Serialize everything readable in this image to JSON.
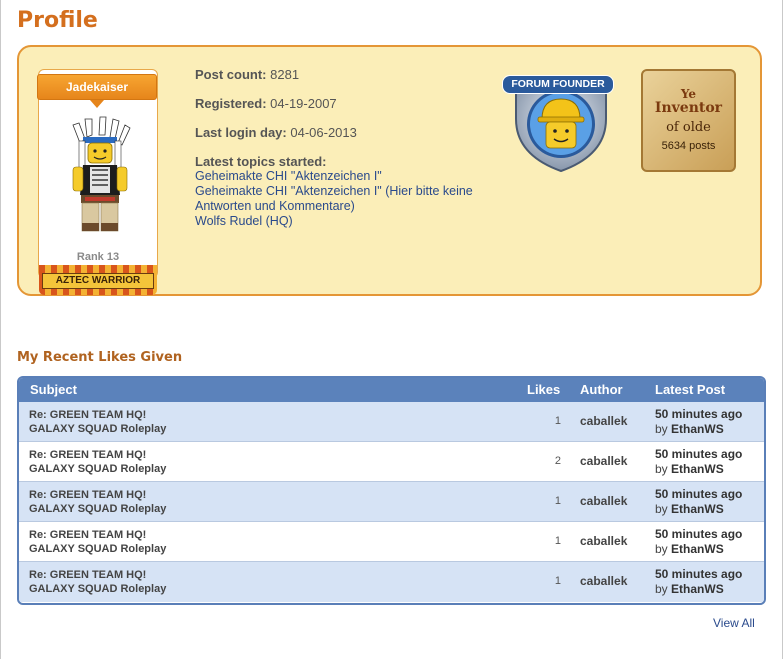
{
  "page": {
    "title": "Profile"
  },
  "card": {
    "name": "Jadekaiser",
    "rank": "Rank 13",
    "banner": "AZTEC WARRIOR"
  },
  "info": {
    "post_count_label": "Post count:",
    "post_count": "8281",
    "registered_label": "Registered:",
    "registered": "04-19-2007",
    "last_login_label": "Last login day:",
    "last_login": "04-06-2013",
    "topics_label": "Latest topics started:",
    "topics": [
      "Geheimakte CHI \"Aktenzeichen I\"",
      "Geheimakte CHI \"Aktenzeichen I\" (Hier bitte keine Antworten und Kommentare)",
      "Wolfs Rudel (HQ)"
    ]
  },
  "badges": {
    "founder": "FORUM FOUNDER",
    "inventor_line1": "Ye",
    "inventor_line2": "Inventor",
    "inventor_line3": "of olde",
    "inventor_posts": "5634 posts"
  },
  "likes": {
    "title": "My Recent Likes Given",
    "columns": {
      "subject": "Subject",
      "likes": "Likes",
      "author": "Author",
      "latest": "Latest Post"
    },
    "rows": [
      {
        "subject": "Re: GREEN TEAM HQ!",
        "forum": "GALAXY SQUAD Roleplay",
        "likes": "1",
        "author": "caballek",
        "time": "50 minutes ago",
        "by_prefix": "by",
        "by": "EthanWS"
      },
      {
        "subject": "Re: GREEN TEAM HQ!",
        "forum": "GALAXY SQUAD Roleplay",
        "likes": "2",
        "author": "caballek",
        "time": "50 minutes ago",
        "by_prefix": "by",
        "by": "EthanWS"
      },
      {
        "subject": "Re: GREEN TEAM HQ!",
        "forum": "GALAXY SQUAD Roleplay",
        "likes": "1",
        "author": "caballek",
        "time": "50 minutes ago",
        "by_prefix": "by",
        "by": "EthanWS"
      },
      {
        "subject": "Re: GREEN TEAM HQ!",
        "forum": "GALAXY SQUAD Roleplay",
        "likes": "1",
        "author": "caballek",
        "time": "50 minutes ago",
        "by_prefix": "by",
        "by": "EthanWS"
      },
      {
        "subject": "Re: GREEN TEAM HQ!",
        "forum": "GALAXY SQUAD Roleplay",
        "likes": "1",
        "author": "caballek",
        "time": "50 minutes ago",
        "by_prefix": "by",
        "by": "EthanWS"
      }
    ],
    "view_all": "View All"
  },
  "colors": {
    "accent": "#d46f1e",
    "panel": "#fbeeb8",
    "table_header": "#5b82bb",
    "row_alt": "#d6e3f5"
  }
}
